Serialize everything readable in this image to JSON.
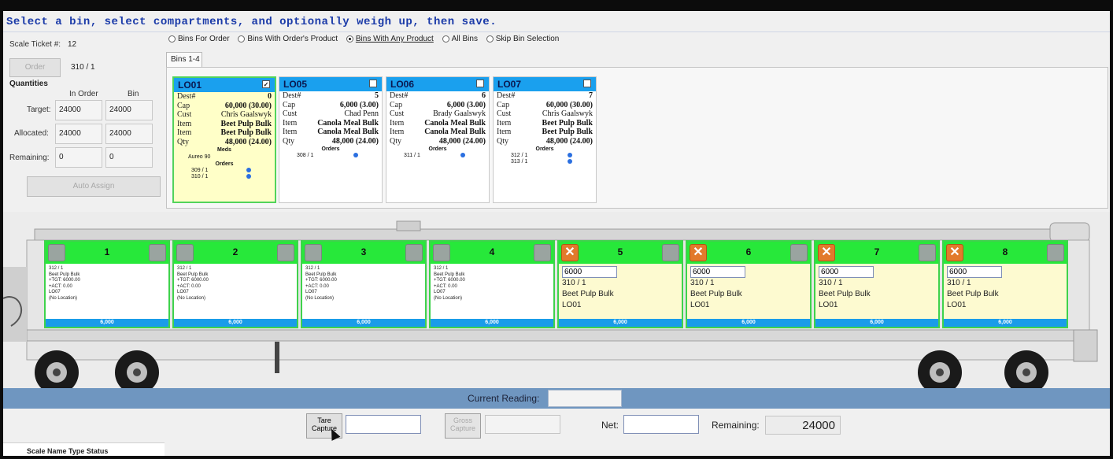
{
  "instruction": "Select a bin, select compartments, and optionally weigh up, then save.",
  "left": {
    "scale_ticket_label": "Scale Ticket #:",
    "scale_ticket_value": "12",
    "order_button": "Order",
    "order_value": "310 / 1",
    "quantities_label": "Quantities",
    "col_in_order": "In Order",
    "col_bin": "Bin",
    "target_label": "Target:",
    "target_order": "24000",
    "target_bin": "24000",
    "allocated_label": "Allocated:",
    "allocated_order": "24000",
    "allocated_bin": "24000",
    "remaining_label": "Remaining:",
    "remaining_order": "0",
    "remaining_bin": "0",
    "auto_assign_button": "Auto Assign"
  },
  "radios": [
    {
      "label": "Bins For Order",
      "selected": false
    },
    {
      "label": "Bins With Order's Product",
      "selected": false
    },
    {
      "label": "Bins With Any Product",
      "selected": true
    },
    {
      "label": "All Bins",
      "selected": false
    },
    {
      "label": "Skip Bin Selection",
      "selected": false
    }
  ],
  "tab_label": "Bins 1-4",
  "bins": [
    {
      "name": "LO01",
      "checked": true,
      "dest": "0",
      "cap": "60,000 (30.00)",
      "cust": "Chris Gaalswyk",
      "item1": "Beet Pulp Bulk",
      "item2": "Beet Pulp Bulk",
      "qty": "48,000 (24.00)",
      "meds_label": "Meds",
      "meds": "Aureo 90",
      "orders_label": "Orders",
      "orders": [
        "309 / 1",
        "310 / 1"
      ]
    },
    {
      "name": "LO05",
      "checked": false,
      "dest": "5",
      "cap": "6,000 (3.00)",
      "cust": "Chad Penn",
      "item1": "Canola Meal Bulk",
      "item2": "Canola Meal Bulk",
      "qty": "48,000 (24.00)",
      "orders_label": "Orders",
      "orders": [
        "308 / 1"
      ]
    },
    {
      "name": "LO06",
      "checked": false,
      "dest": "6",
      "cap": "6,000 (3.00)",
      "cust": "Brady Gaalswyk",
      "item1": "Canola Meal Bulk",
      "item2": "Canola Meal Bulk",
      "qty": "48,000 (24.00)",
      "orders_label": "Orders",
      "orders": [
        "311 / 1"
      ]
    },
    {
      "name": "LO07",
      "checked": false,
      "dest": "7",
      "cap": "60,000 (30.00)",
      "cust": "Chris Gaalswyk",
      "item1": "Beet Pulp Bulk",
      "item2": "Beet Pulp Bulk",
      "qty": "48,000 (24.00)",
      "orders_label": "Orders",
      "orders": [
        "312 / 1",
        "313 / 1"
      ]
    }
  ],
  "bin_keys": {
    "dest": "Dest#",
    "cap": "Cap",
    "cust": "Cust",
    "item": "Item",
    "qty": "Qty"
  },
  "compartments": [
    {
      "num": "1",
      "mode": "filled",
      "detail": [
        "312 / 1",
        "Beet Pulp Bulk",
        "+TGT: 6000.00",
        "+ACT: 0.00",
        "LO07",
        "(No Location)"
      ],
      "total": "6,000"
    },
    {
      "num": "2",
      "mode": "filled",
      "detail": [
        "312 / 1",
        "Beet Pulp Bulk",
        "+TGT: 6000.00",
        "+ACT: 0.00",
        "LO07",
        "(No Location)"
      ],
      "total": "6,000"
    },
    {
      "num": "3",
      "mode": "filled",
      "detail": [
        "312 / 1",
        "Beet Pulp Bulk",
        "+TGT: 6000.00",
        "+ACT: 0.00",
        "LO07",
        "(No Location)"
      ],
      "total": "6,000"
    },
    {
      "num": "4",
      "mode": "filled",
      "detail": [
        "312 / 1",
        "Beet Pulp Bulk",
        "+TGT: 6000.00",
        "+ACT: 0.00",
        "LO07",
        "(No Location)"
      ],
      "total": "6,000"
    },
    {
      "num": "5",
      "mode": "open",
      "input": "6000",
      "order": "310 / 1",
      "product": "Beet Pulp Bulk",
      "bin": "LO01",
      "total": "6,000"
    },
    {
      "num": "6",
      "mode": "open",
      "input": "6000",
      "order": "310 / 1",
      "product": "Beet Pulp Bulk",
      "bin": "LO01",
      "total": "6,000"
    },
    {
      "num": "7",
      "mode": "open",
      "input": "6000",
      "order": "310 / 1",
      "product": "Beet Pulp Bulk",
      "bin": "LO01",
      "total": "6,000"
    },
    {
      "num": "8",
      "mode": "open",
      "input": "6000",
      "order": "310 / 1",
      "product": "Beet Pulp Bulk",
      "bin": "LO01",
      "total": "6,000"
    }
  ],
  "bottom": {
    "current_reading_label": "Current Reading:",
    "tare_button": "Tare Capture",
    "gross_button": "Gross Capture",
    "net_label": "Net:",
    "remaining_label": "Remaining:",
    "remaining_value": "24000",
    "scale_table_header": "Scale Name Type   Status"
  },
  "colors": {
    "bin_header": "#1aa0ee",
    "compartment_header": "#27e83a",
    "reading_bar": "#6f96c0",
    "instruction_text": "#1a3aa8"
  }
}
